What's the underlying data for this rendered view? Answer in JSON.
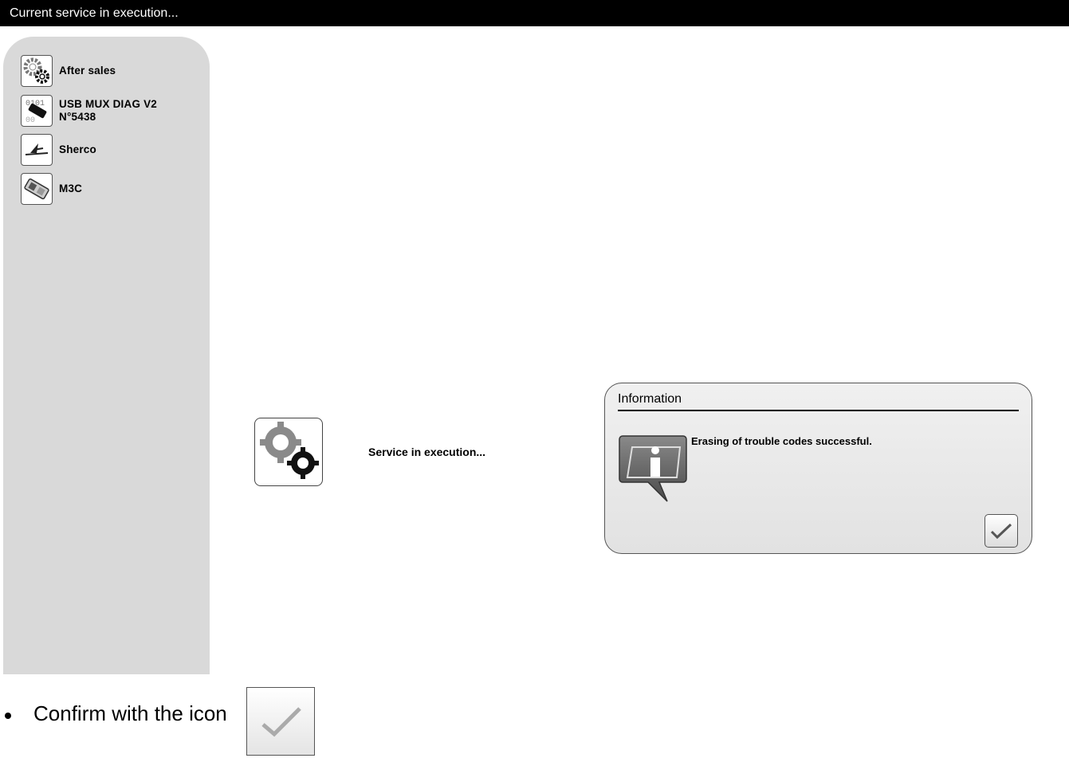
{
  "titlebar": {
    "title": "Current service in execution..."
  },
  "sidebar": {
    "items": [
      {
        "label": "After sales",
        "icon": "gears-icon"
      },
      {
        "label": "USB MUX DIAG V2\nN°5438",
        "icon": "usb-interface-icon"
      },
      {
        "label": "Sherco",
        "icon": "sherco-logo-icon"
      },
      {
        "label": "M3C",
        "icon": "ecu-module-icon"
      }
    ]
  },
  "main": {
    "status_text": "Service in execution..."
  },
  "dialog": {
    "title": "Information",
    "message": "Erasing of trouble codes successful."
  },
  "instruction": {
    "text": "Confirm with the icon"
  }
}
